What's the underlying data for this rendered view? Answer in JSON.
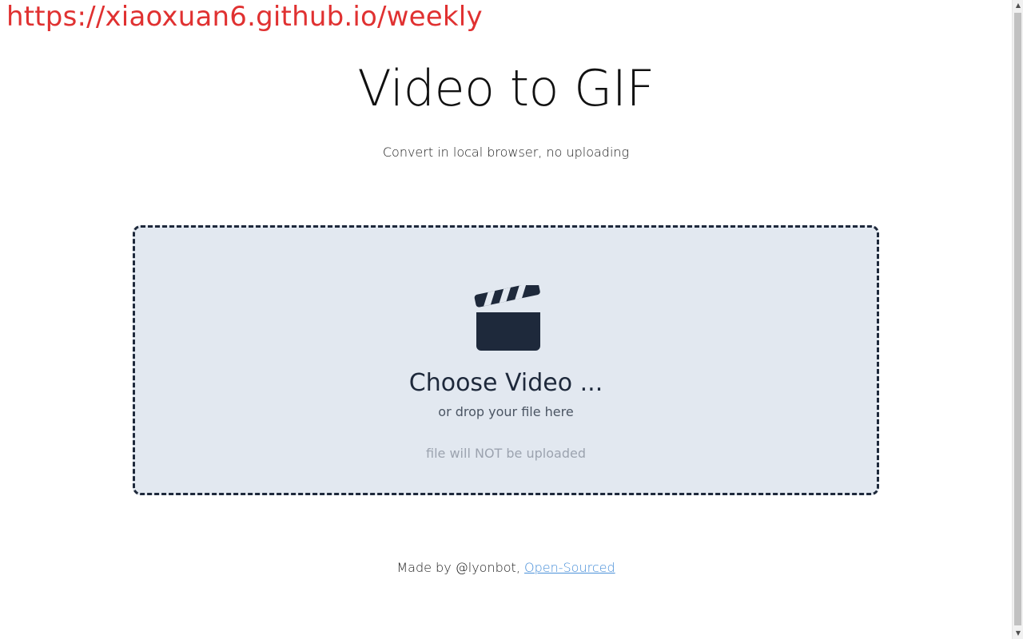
{
  "watermark": {
    "text": "https://xiaoxuan6.github.io/weekly"
  },
  "header": {
    "title": "Video to GIF",
    "subtitle": "Convert in local browser, no uploading"
  },
  "dropzone": {
    "icon": "clapperboard-icon",
    "choose_label": "Choose Video ...",
    "drop_label": "or drop your file here",
    "note": "file will NOT be uploaded"
  },
  "footer": {
    "made_by": "Made by @lyonbot,",
    "link_label": "Open-Sourced"
  },
  "colors": {
    "watermark": "#e03131",
    "dropzone_bg": "#e2e8f0",
    "dropzone_border": "#1e293b",
    "link": "#4a90d9"
  }
}
